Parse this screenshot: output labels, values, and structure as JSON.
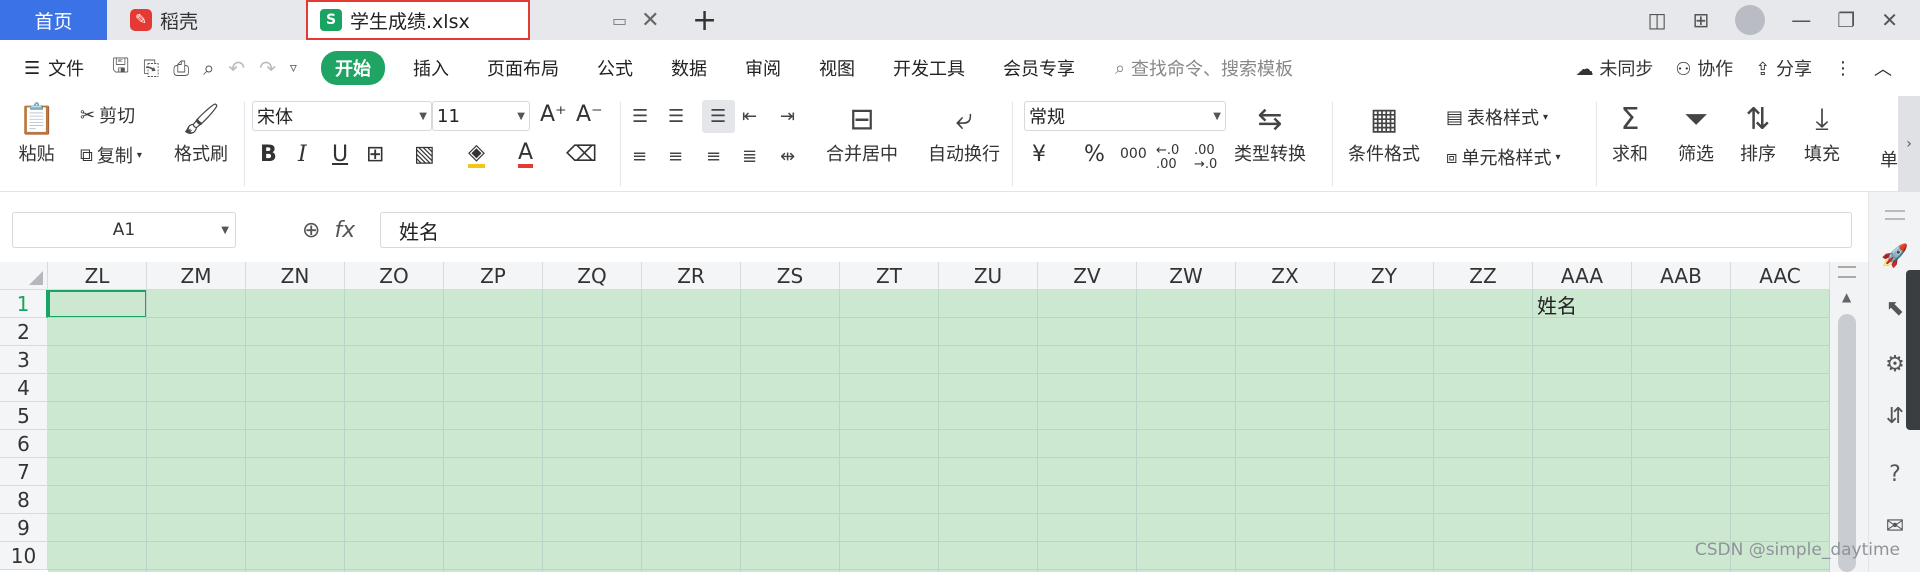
{
  "tabs": {
    "home": "首页",
    "daoke": "稻壳",
    "doc": "学生成绩.xlsx",
    "doc_logo": "S"
  },
  "menu": {
    "file": "文件",
    "start": "开始",
    "items": [
      "插入",
      "页面布局",
      "公式",
      "数据",
      "审阅",
      "视图",
      "开发工具",
      "会员专享"
    ],
    "search_placeholder": "查找命令、搜索模板",
    "sync": "未同步",
    "collab": "协作",
    "share": "分享"
  },
  "ribbon": {
    "paste": "粘贴",
    "cut": "剪切",
    "copy": "复制",
    "format_painter": "格式刷",
    "font_name": "宋体",
    "font_size": "11",
    "merge_center": "合并居中",
    "wrap_text": "自动换行",
    "number_format": "常规",
    "type_convert": "类型转换",
    "cond_format": "条件格式",
    "table_style": "表格样式",
    "cell_style": "单元格样式",
    "sum": "求和",
    "filter": "筛选",
    "sort": "排序",
    "fill": "填充",
    "cut_off": "单"
  },
  "formula": {
    "name_box": "A1",
    "fx": "fx",
    "value": "姓名"
  },
  "sheet": {
    "columns": [
      "ZL",
      "ZM",
      "ZN",
      "ZO",
      "ZP",
      "ZQ",
      "ZR",
      "ZS",
      "ZT",
      "ZU",
      "ZV",
      "ZW",
      "ZX",
      "ZY",
      "ZZ",
      "AAA",
      "AAB",
      "AAC"
    ],
    "rows": [
      "1",
      "2",
      "3",
      "4",
      "5",
      "6",
      "7",
      "8",
      "9",
      "10"
    ],
    "active_row": "1",
    "cell_value": "姓名",
    "cell_column": "AAA",
    "cell_fill": "#cde8d0",
    "accent": "#1aa463"
  },
  "watermark": "CSDN @simple_daytime"
}
